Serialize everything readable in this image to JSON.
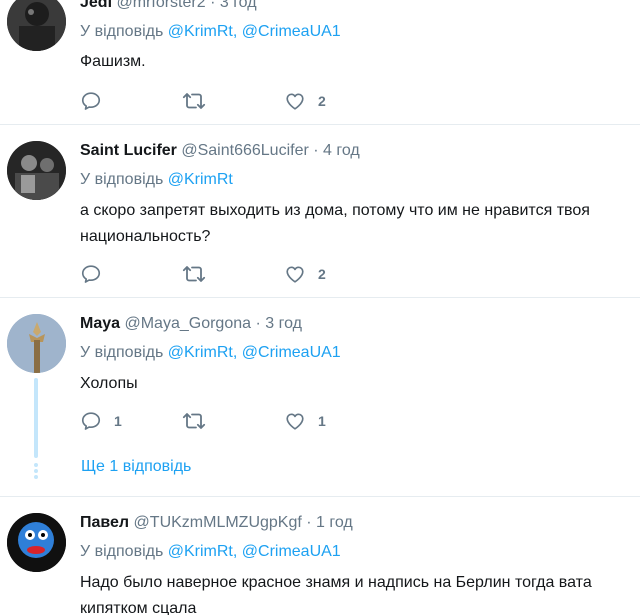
{
  "colors": {
    "link": "#1da1f2",
    "muted": "#657786",
    "text": "#14171a",
    "divider": "#e6ecf0",
    "thread": "#c4e6fb"
  },
  "icons": {
    "reply": "reply-icon",
    "retweet": "retweet-icon",
    "like": "like-icon"
  },
  "tweets": [
    {
      "name": "Jedi",
      "handle": "@mrforster2",
      "sep": "·",
      "time": "3 год",
      "reply_prefix": "У відповідь",
      "reply_to": "@KrimRt, @CrimeaUA1",
      "text": "Фашизм.",
      "reply_count": "",
      "retweet_count": "",
      "like_count": "2"
    },
    {
      "name": "Saint Lucifer",
      "handle": "@Saint666Lucifer",
      "sep": "·",
      "time": "4 год",
      "reply_prefix": "У відповідь",
      "reply_to": "@KrimRt",
      "text": "а скоро запретят выходить из дома, потому что им не нравится твоя национальность?",
      "reply_count": "",
      "retweet_count": "",
      "like_count": "2"
    },
    {
      "name": "Maya",
      "handle": "@Maya_Gorgona",
      "sep": "·",
      "time": "3 год",
      "reply_prefix": "У відповідь",
      "reply_to": "@KrimRt, @CrimeaUA1",
      "text": "Холопы",
      "reply_count": "1",
      "retweet_count": "",
      "like_count": "1",
      "more_replies": "Ще 1 відповідь"
    },
    {
      "name": "Павел",
      "handle": "@TUKzmMLMZUgpKgf",
      "sep": "·",
      "time": "1 год",
      "reply_prefix": "У відповідь",
      "reply_to": "@KrimRt, @CrimeaUA1",
      "text": "Надо было наверное красное знамя и надпись на Берлин тогда вата кипятком сцала"
    }
  ]
}
